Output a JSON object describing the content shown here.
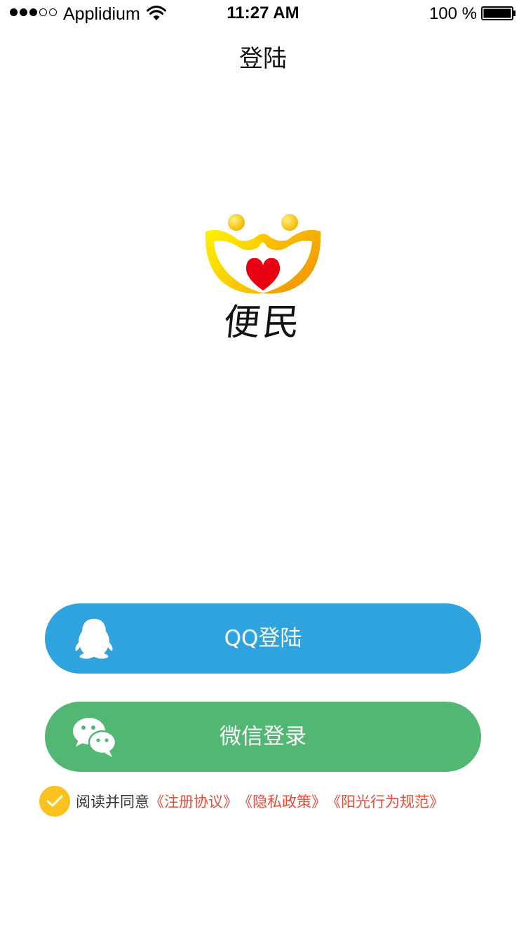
{
  "status_bar": {
    "carrier": "Applidium",
    "time": "11:27 AM",
    "battery_percent": "100 %",
    "battery_level": 1.0,
    "signal_strength": 3,
    "signal_max": 5,
    "icons": [
      "signal-dots-icon",
      "wifi-icon",
      "battery-icon"
    ]
  },
  "header": {
    "title": "登陆"
  },
  "logo": {
    "text": "便民",
    "icon": "two-people-heart-logo",
    "colors": {
      "gold": "#fcd000",
      "orange": "#f39800",
      "heart": "#e60012"
    }
  },
  "buttons": {
    "qq": {
      "label": "QQ登陆",
      "icon": "qq-penguin-icon",
      "color": "#2fa3dd"
    },
    "wechat": {
      "label": "微信登录",
      "icon": "wechat-icon",
      "color": "#51b773"
    }
  },
  "agreement": {
    "checked": true,
    "check_color": "#fbc21e",
    "prefix": "阅读并同意",
    "links": [
      "《注册协议》",
      "《隐私政策》",
      "《阳光行为规范》"
    ],
    "link_color": "#ea4c3b"
  }
}
